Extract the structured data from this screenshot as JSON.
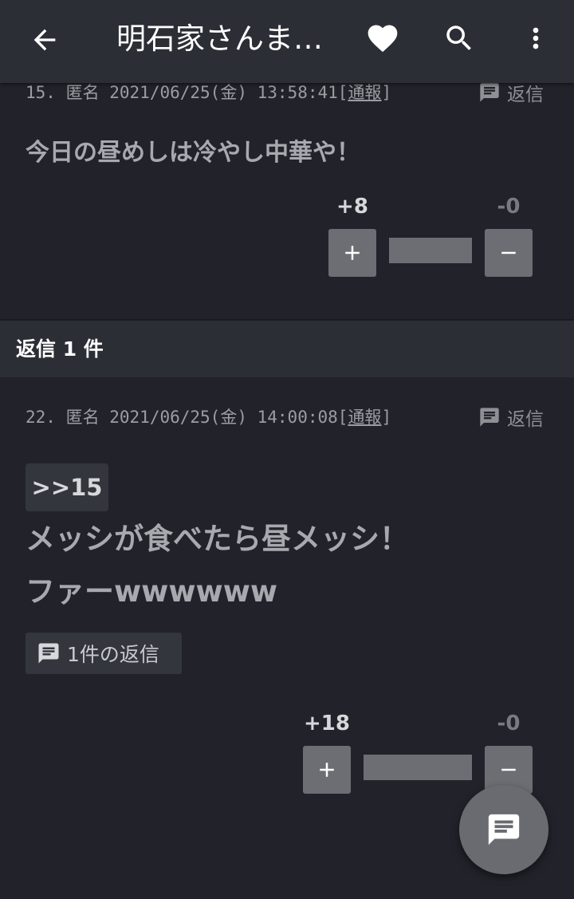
{
  "appbar": {
    "title": "明石家さんま…",
    "icons": [
      "back-arrow-icon",
      "heart-icon",
      "search-icon",
      "more-vert-icon"
    ]
  },
  "posts": [
    {
      "number": "15.",
      "author": "匿名",
      "date": "2021/06/25(金)",
      "time": "13:58:41",
      "report_open": "[",
      "report_label": "通報",
      "report_close": "]",
      "reply_label": "返信",
      "text": "今日の昼めしは冷やし中華や！",
      "upvotes": "+8",
      "downvotes": "-0",
      "plus_label": "+",
      "minus_label": "−"
    },
    {
      "number": "22.",
      "author": "匿名",
      "date": "2021/06/25(金)",
      "time": "14:00:08",
      "report_open": "[",
      "report_label": "通報",
      "report_close": "]",
      "reply_label": "返信",
      "anchor": ">>15",
      "text_line1": "メッシが食べたら昼メッシ！",
      "text_line2": "ファーwwwwww",
      "replies_count_label": "1件の返信",
      "upvotes": "+18",
      "downvotes": "-0",
      "plus_label": "+",
      "minus_label": "−"
    }
  ],
  "section": {
    "label": "返信 1 件"
  },
  "colors": {
    "background": "#22232a",
    "appbar": "#2c2e35",
    "button": "#6d6e73",
    "chip": "#34363e"
  }
}
